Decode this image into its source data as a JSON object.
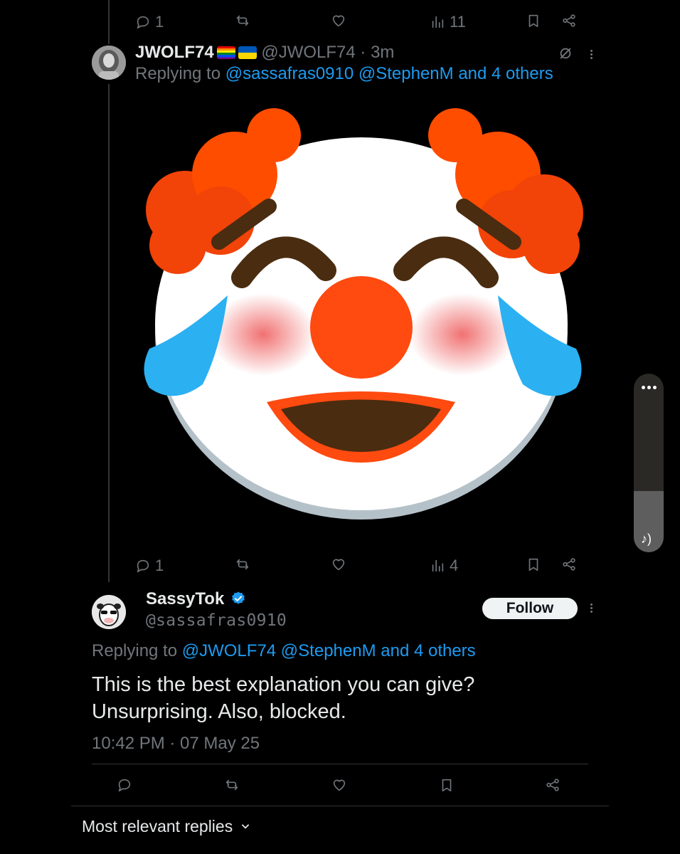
{
  "top_tweet_actions": {
    "replies": "1",
    "views": "11"
  },
  "reply_tweet": {
    "display_name": "JWOLF74",
    "handle_time": "@JWOLF74 · 3m",
    "replying_prefix": "Replying to",
    "replying_targets": "@sassafras0910 @StephenM and 4 others",
    "media": "clown-face-emoji",
    "actions": {
      "replies": "1",
      "views": "4"
    }
  },
  "main_tweet": {
    "display_name": "SassyTok",
    "handle": "@sassafras0910",
    "follow_label": "Follow",
    "replying_prefix": "Replying to",
    "replying_targets": "@JWOLF74 @StephenM and 4 others",
    "text_line1": "This is the best explanation you can give?",
    "text_line2": "Unsurprising. Also, blocked.",
    "timestamp": "10:42 PM · 07 May 25"
  },
  "replies_sort": {
    "label": "Most relevant replies"
  },
  "colors": {
    "background": "#000000",
    "link": "#1d9bf0",
    "muted": "#71767b",
    "text": "#e7e9ea",
    "verified": "#1d9bf0"
  }
}
